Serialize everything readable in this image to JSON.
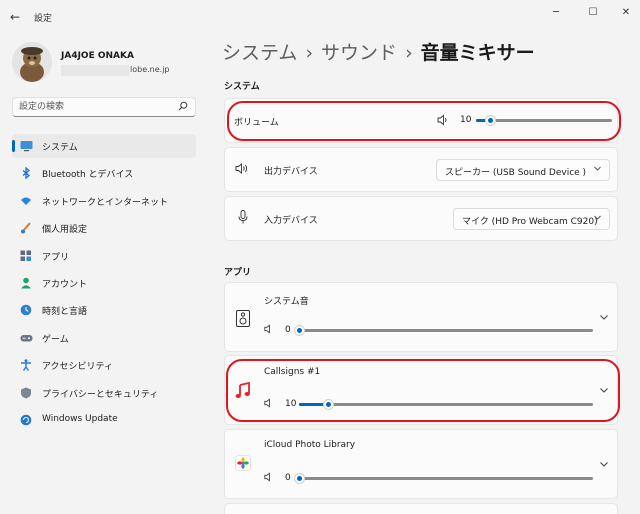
{
  "window": {
    "title": "設定",
    "back_glyph": "←",
    "minimize_glyph": "─",
    "maximize_glyph": "☐",
    "close_glyph": "✕"
  },
  "profile": {
    "name": "JA4JOE ONAKA",
    "email_visible": "lobe.ne.jp"
  },
  "search": {
    "placeholder": "設定の検索",
    "icon": "search-icon"
  },
  "sidebar": {
    "accent": "#0067c0",
    "items": [
      {
        "label": "システム",
        "icon": "system-icon",
        "active": true
      },
      {
        "label": "Bluetooth とデバイス",
        "icon": "bluetooth-icon"
      },
      {
        "label": "ネットワークとインターネット",
        "icon": "network-icon"
      },
      {
        "label": "個人用設定",
        "icon": "personalization-icon"
      },
      {
        "label": "アプリ",
        "icon": "apps-icon"
      },
      {
        "label": "アカウント",
        "icon": "accounts-icon"
      },
      {
        "label": "時刻と言語",
        "icon": "time-language-icon"
      },
      {
        "label": "ゲーム",
        "icon": "gaming-icon"
      },
      {
        "label": "アクセシビリティ",
        "icon": "accessibility-icon"
      },
      {
        "label": "プライバシーとセキュリティ",
        "icon": "privacy-icon"
      },
      {
        "label": "Windows Update",
        "icon": "windows-update-icon"
      }
    ]
  },
  "breadcrumb": {
    "items": [
      "システム",
      "サウンド",
      "音量ミキサー"
    ],
    "separator": "›"
  },
  "system_section": {
    "title": "システム",
    "volume": {
      "label": "ボリューム",
      "value": "10",
      "level": 0.1,
      "icon": "speaker-icon"
    },
    "output": {
      "label": "出力デバイス",
      "selected": "スピーカー (USB Sound Device      )",
      "icon": "speaker-output-icon"
    },
    "input": {
      "label": "入力デバイス",
      "selected": "マイク (HD Pro Webcam C920)",
      "icon": "microphone-icon"
    }
  },
  "apps_section": {
    "title": "アプリ",
    "apps": [
      {
        "name": "システム音",
        "value": "0",
        "level": 0.0,
        "icon": "system-sounds-icon"
      },
      {
        "name": "Callsigns #1",
        "value": "10",
        "level": 0.1,
        "icon": "music-note-icon"
      },
      {
        "name": "iCloud Photo Library",
        "value": "0",
        "level": 0.0,
        "icon": "photos-icon"
      }
    ]
  },
  "colors": {
    "accent": "#0067c0",
    "highlight": "#e0141e"
  }
}
